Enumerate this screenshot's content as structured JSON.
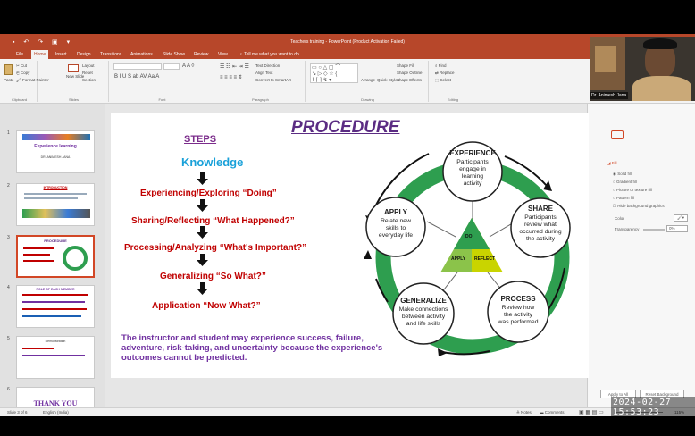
{
  "app": {
    "title": "Teachers training - PowerPoint (Product Activation Failed)",
    "tabs": [
      "File",
      "Home",
      "Insert",
      "Design",
      "Transitions",
      "Animations",
      "Slide Show",
      "Review",
      "View"
    ],
    "active_tab": "Home",
    "tell_me": "Tell me what you want to do..."
  },
  "ribbon": {
    "clipboard": {
      "label": "Clipboard",
      "paste": "Paste",
      "cut": "Cut",
      "copy": "Copy",
      "format_painter": "Format Painter"
    },
    "slides": {
      "label": "Slides",
      "new_slide": "New Slide",
      "layout": "Layout",
      "reset": "Reset",
      "section": "Section"
    },
    "font": {
      "label": "Font"
    },
    "paragraph": {
      "label": "Paragraph",
      "text_direction": "Text Direction",
      "align_text": "Align Text",
      "smartart": "Convert to SmartArt"
    },
    "drawing": {
      "label": "Drawing",
      "arrange": "Arrange",
      "quick_styles": "Quick Styles",
      "shape_fill": "Shape Fill",
      "shape_outline": "Shape Outline",
      "shape_effects": "Shape Effects"
    },
    "editing": {
      "label": "Editing",
      "find": "Find",
      "replace": "Replace",
      "select": "Select"
    }
  },
  "thumbnails": [
    {
      "num": "1",
      "title": "Experience learning",
      "sub": "DR. ANIMESH JANA"
    },
    {
      "num": "2",
      "title": "INTRODUCTION"
    },
    {
      "num": "3",
      "title": "PROCEDURE"
    },
    {
      "num": "4",
      "title": "ROLE OF EACH MEMBER"
    },
    {
      "num": "5",
      "title": "Demonstration"
    },
    {
      "num": "6",
      "title": "THANK YOU"
    }
  ],
  "slide": {
    "title": "PROCEDURE",
    "steps_heading": "STEPS",
    "knowledge": "Knowledge",
    "steps": [
      "Experiencing/Exploring “Doing”",
      "Sharing/Reflecting “What Happened?”",
      "Processing/Analyzing “What's Important?”",
      "Generalizing “So What?”",
      "Application “Now What?”"
    ],
    "footer": "The instructor and student may experience success, failure, adventure, risk-taking, and uncertainty because the experience's outcomes cannot be predicted.",
    "cycle": {
      "experience": {
        "title": "EXPERIENCE",
        "text": [
          "Participants",
          "engage in",
          "learning",
          "activity"
        ]
      },
      "share": {
        "title": "SHARE",
        "text": [
          "Participants",
          "review what",
          "occurred during",
          "the activity"
        ]
      },
      "process": {
        "title": "PROCESS",
        "text": [
          "Review how",
          "the activity",
          "was performed"
        ]
      },
      "generalize": {
        "title": "GENERALIZE",
        "text": [
          "Make connections",
          "between activity",
          "and life skills"
        ]
      },
      "apply": {
        "title": "APPLY",
        "text": [
          "Relate new",
          "skills to",
          "everyday life"
        ]
      },
      "triangle": {
        "top": "DO",
        "left": "APPLY",
        "right": "REFLECT"
      }
    }
  },
  "format_panel": {
    "fill_label": "Fill",
    "options": [
      "Solid fill",
      "Gradient fill",
      "Picture or texture fill",
      "Pattern fill",
      "Hide background graphics"
    ],
    "color_label": "Color",
    "transparency_label": "Transparency",
    "transparency_value": "0%",
    "apply_all": "Apply to All",
    "reset": "Reset Background"
  },
  "status": {
    "slide": "Slide 3 of 6",
    "language": "English (India)",
    "notes": "Notes",
    "comments": "Comments",
    "zoom": "115%"
  },
  "camera": {
    "name": "Dr. Animesh Jana"
  },
  "timestamp": "2024-02-27 15:53:23",
  "colors": {
    "accent": "#b7472a",
    "title": "#5b2c83",
    "steps": "#c00000",
    "knowledge": "#1aa1d9",
    "ring": "#2e9e4f"
  }
}
